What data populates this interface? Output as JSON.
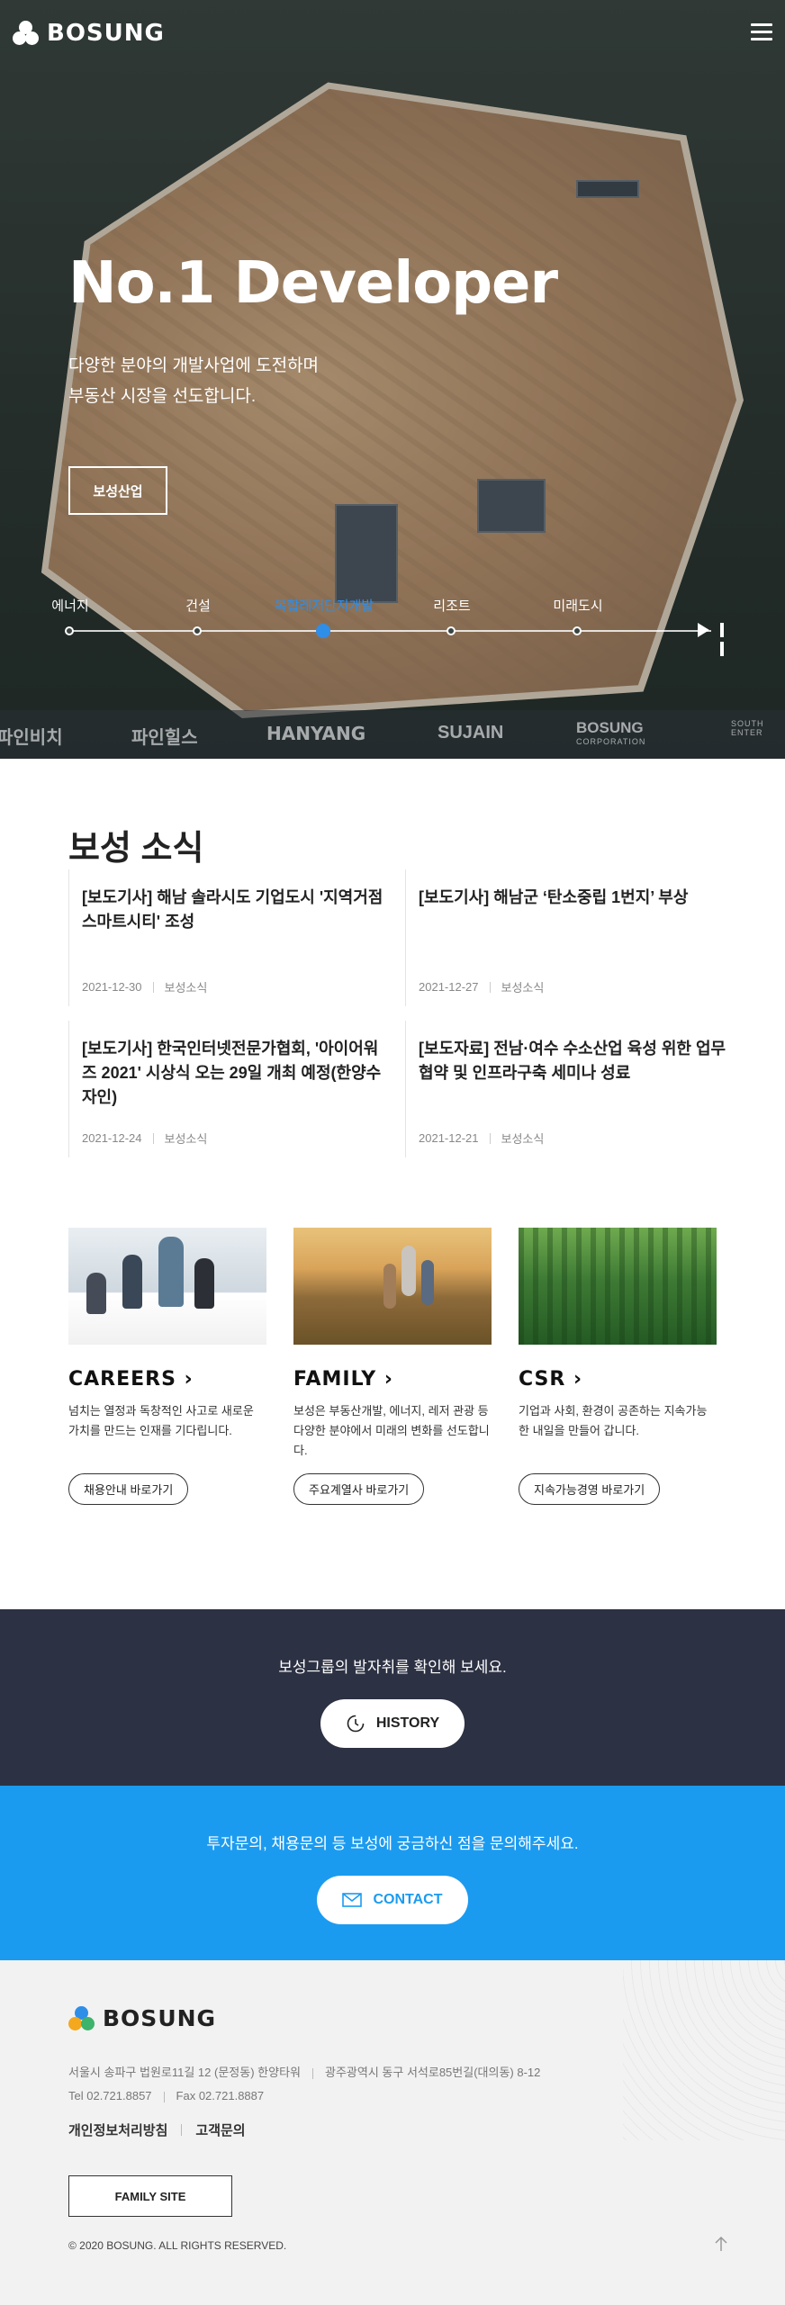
{
  "header": {
    "logo_text": "BOSUNG",
    "menu_icon": "hamburger-menu-icon"
  },
  "hero": {
    "title": "No.1 Developer",
    "desc_line1": "다양한 분야의 개발사업에 도전하며",
    "desc_line2": "부동산 시장을 선도합니다.",
    "button_label": "보성산업",
    "timeline": [
      {
        "label": "에너지"
      },
      {
        "label": "건설"
      },
      {
        "label": "복합레저단지개발",
        "active": true
      },
      {
        "label": "리조트"
      },
      {
        "label": "미래도시"
      }
    ],
    "brands": [
      "파인비치",
      "파인힐스",
      "HANYANG",
      "SUJAIN",
      "BOSUNG",
      "SOUTH"
    ],
    "brand_subs": [
      "",
      "",
      "",
      "",
      "CORPORATION",
      "ENTER"
    ]
  },
  "news": {
    "title": "보성 소식",
    "items": [
      {
        "title": "[보도기사] 해남 솔라시도 기업도시 '지역거점 스마트시티' 조성",
        "date": "2021-12-30",
        "category": "보성소식"
      },
      {
        "title": "[보도기사] 해남군 ‘탄소중립 1번지’ 부상",
        "date": "2021-12-27",
        "category": "보성소식"
      },
      {
        "title": "[보도기사] 한국인터넷전문가협회, '아이어워즈 2021' 시상식 오는 29일 개최 예정(한양수자인)",
        "date": "2021-12-24",
        "category": "보성소식"
      },
      {
        "title": "[보도자료] 전남·여수 수소산업 육성 위한 업무협약 및 인프라구축 세미나 성료",
        "date": "2021-12-21",
        "category": "보성소식"
      }
    ]
  },
  "promos": [
    {
      "heading": "CAREERS",
      "desc": "넘치는 열정과 독창적인 사고로 새로운 가치를 만드는 인재를 기다립니다.",
      "button": "채용안내 바로가기"
    },
    {
      "heading": "FAMILY",
      "desc": "보성은 부동산개발, 에너지, 레저 관광 등 다양한 분야에서 미래의 변화를 선도합니다.",
      "button": "주요계열사 바로가기"
    },
    {
      "heading": "CSR",
      "desc": "기업과 사회, 환경이 공존하는 지속가능한 내일을 만들어 갑니다.",
      "button": "지속가능경영 바로가기"
    }
  ],
  "history": {
    "text": "보성그룹의 발자취를 확인해 보세요.",
    "button": "HISTORY"
  },
  "contact": {
    "text": "투자문의, 채용문의 등 보성에 궁금하신 점을 문의해주세요.",
    "button": "CONTACT"
  },
  "footer": {
    "logo_text": "BOSUNG",
    "address1": "서울시 송파구 법원로11길 12 (문정동) 한양타워",
    "address2": "광주광역시 동구 서석로85번길(대의동) 8-12",
    "tel": "Tel 02.721.8857",
    "fax": "Fax 02.721.8887",
    "link_privacy": "개인정보처리방침",
    "link_support": "고객문의",
    "family_site": "FAMILY SITE",
    "copyright": "© 2020 BOSUNG. ALL RIGHTS RESERVED."
  },
  "colors": {
    "accent_blue": "#1b9bf0",
    "timeline_active": "#2f8ee8",
    "history_band": "#2c3143",
    "footer_bg": "#f2f2f2"
  }
}
